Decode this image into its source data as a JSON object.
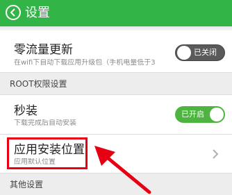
{
  "header": {
    "title": "设置"
  },
  "zero_traffic": {
    "title": "零流量更新",
    "subtitle": "在wifi下自动下载应用升级包（手机电量低于3",
    "toggle_text": "已关闭",
    "enabled": false
  },
  "section_root": {
    "label": "ROOT权限设置"
  },
  "seconds_install": {
    "title": "秒装",
    "subtitle": "下载完成后自动安装",
    "toggle_text": "已开启",
    "enabled": true
  },
  "install_location": {
    "title": "应用安装位置",
    "subtitle": "应用默认位置"
  },
  "section_other": {
    "label": "其他设置"
  },
  "colors": {
    "header": "#33b446",
    "toggle_on": "#4cb43f",
    "toggle_off": "#5a5a5a",
    "annotation": "#e60012"
  }
}
